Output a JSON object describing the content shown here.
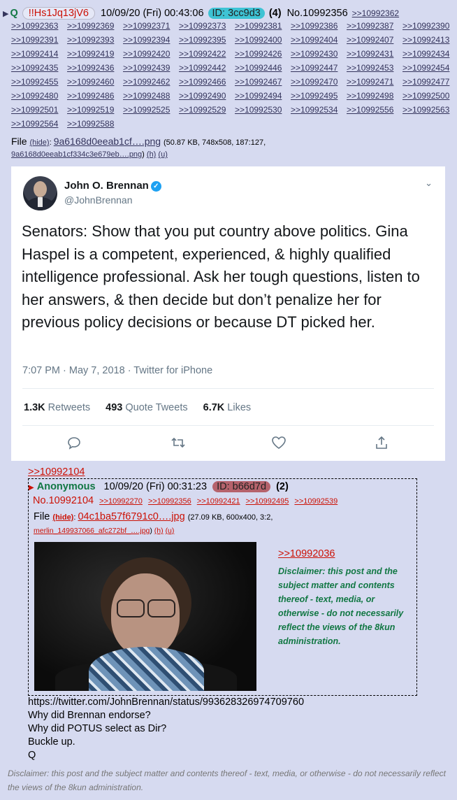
{
  "post": {
    "name": "Q",
    "tripcode": "!!Hs1Jq13jV6",
    "datetime": "10/09/20 (Fri) 00:43:06",
    "id": "ID: 3cc9d3",
    "count": "(4)",
    "number": "No.10992356",
    "backlinks": [
      ">>10992362",
      ">>10992363",
      ">>10992369",
      ">>10992371",
      ">>10992373",
      ">>10992381",
      ">>10992386",
      ">>10992387",
      ">>10992390",
      ">>10992391",
      ">>10992393",
      ">>10992394",
      ">>10992395",
      ">>10992400",
      ">>10992404",
      ">>10992407",
      ">>10992413",
      ">>10992414",
      ">>10992419",
      ">>10992420",
      ">>10992422",
      ">>10992426",
      ">>10992430",
      ">>10992431",
      ">>10992434",
      ">>10992435",
      ">>10992436",
      ">>10992439",
      ">>10992442",
      ">>10992446",
      ">>10992447",
      ">>10992453",
      ">>10992454",
      ">>10992455",
      ">>10992460",
      ">>10992462",
      ">>10992466",
      ">>10992467",
      ">>10992470",
      ">>10992471",
      ">>10992477",
      ">>10992480",
      ">>10992486",
      ">>10992488",
      ">>10992490",
      ">>10992494",
      ">>10992495",
      ">>10992498",
      ">>10992500",
      ">>10992501",
      ">>10992519",
      ">>10992525",
      ">>10992529",
      ">>10992530",
      ">>10992534",
      ">>10992556",
      ">>10992563",
      ">>10992564",
      ">>10992588"
    ],
    "file_label": "File",
    "hide": "(hide)",
    "file_name": "9a6168d0eeab1cf….png",
    "file_meta": "(50.87 KB, 748x508, 187:127,",
    "file_orig": "9a6168d0eeab1cf334c3e679eb….png",
    "file_orig_close": ")",
    "h": "(h)",
    "u": "(u)",
    "body_lines": "https://twitter.com/JohnBrennan/status/993628326974709760\nWhy did Brennan endorse?\nWhy did POTUS select as Dir?\nBuckle up.\nQ"
  },
  "tweet": {
    "name": "John O. Brennan",
    "handle": "@JohnBrennan",
    "text": "Senators: Show that you put country above politics. Gina Haspel is a competent, experienced, & highly qualified intelligence professional. Ask her tough questions, listen to her answers, & then decide but don’t penalize her for previous policy decisions or because DT picked her.",
    "meta": "7:07 PM · May 7, 2018 · Twitter for iPhone",
    "retweets_num": "1.3K",
    "retweets_label": "Retweets",
    "quotes_num": "493",
    "quotes_label": "Quote Tweets",
    "likes_num": "6.7K",
    "likes_label": "Likes"
  },
  "quote": {
    "reflink": ">>10992104",
    "name": "Anonymous",
    "datetime": "10/09/20 (Fri) 00:31:23",
    "id": "ID: b66d7d",
    "count": "(2)",
    "number": "No.10992104",
    "backlinks": [
      ">>10992270",
      ">>10992356",
      ">>10992421",
      ">>10992495",
      ">>10992539"
    ],
    "file_label": "File",
    "hide": "(hide)",
    "file_name": "04c1ba57f6791c0….jpg",
    "file_meta": "(27.09 KB, 600x400, 3:2,",
    "file_orig": "merlin_149937066_afc272bf_….jpg",
    "file_orig_close": ")",
    "h": "(h)",
    "u": "(u)",
    "inner_ref": ">>10992036",
    "disclaimer": "Disclaimer: this post and the subject matter and contents thereof - text, media, or otherwise - do not necessarily reflect the views of the 8kun administration."
  },
  "footer_disclaimer": "Disclaimer: this post and the subject matter and contents thereof - text, media, or otherwise - do not necessarily reflect the views of the 8kun administration."
}
